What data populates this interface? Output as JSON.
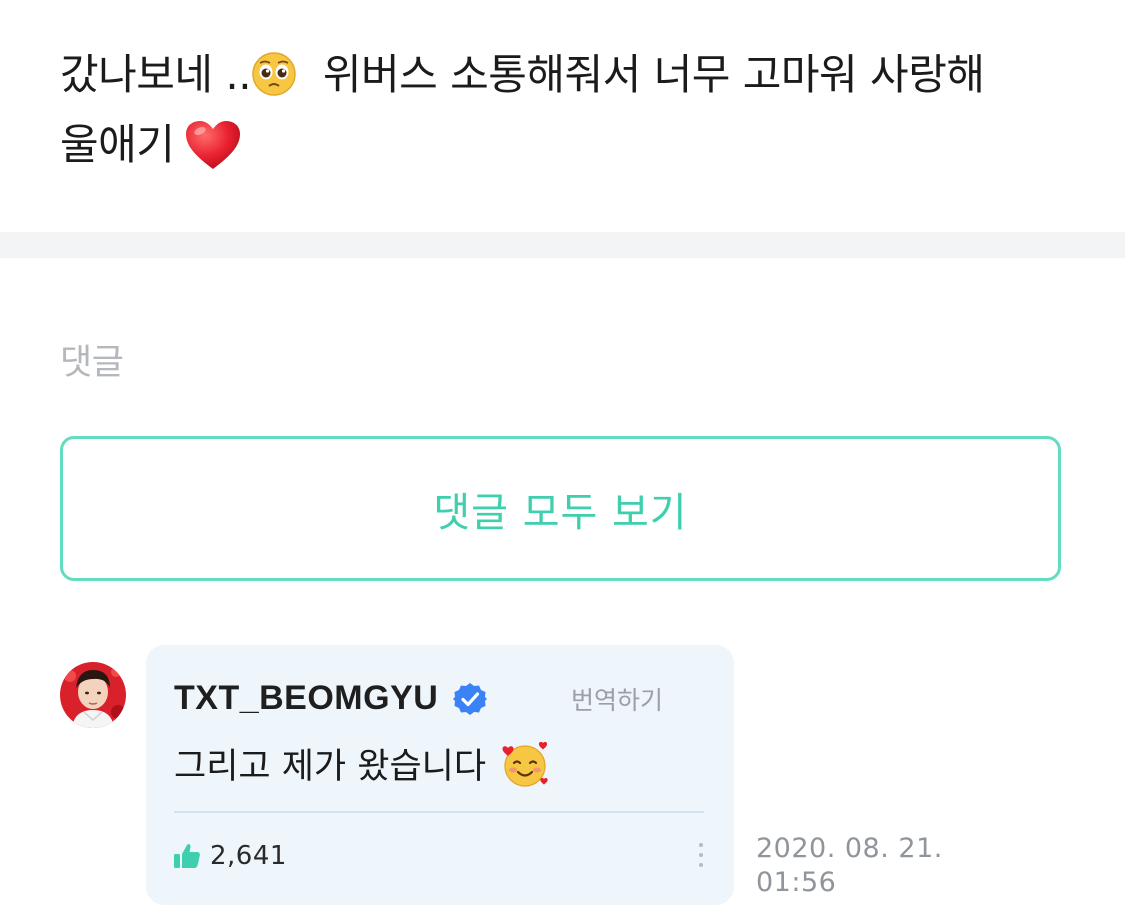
{
  "post": {
    "line1_part1": "갔나보네 ..",
    "line1_part2": "위버스 소통해줘서 너무 고마워 사랑해",
    "line2": "울애기",
    "emoji_1": "pleading-face-emoji",
    "emoji_2": "red-heart-emoji"
  },
  "comments": {
    "heading": "댓글",
    "view_all_label": "댓글 모두 보기"
  },
  "comment": {
    "author": "TXT_BEOMGYU",
    "verified_icon": "verified-badge-icon",
    "translate_label": "번역하기",
    "text": "그리고 제가 왔습니다",
    "emoji": "smiling-face-with-hearts-emoji",
    "likes": "2,641",
    "date": "2020. 08. 21.",
    "time": "01:56"
  },
  "colors": {
    "accent": "#3fcfae",
    "button_border": "#64dcc2",
    "bubble_bg": "#eef6fb",
    "verified": "#3b82f6"
  }
}
